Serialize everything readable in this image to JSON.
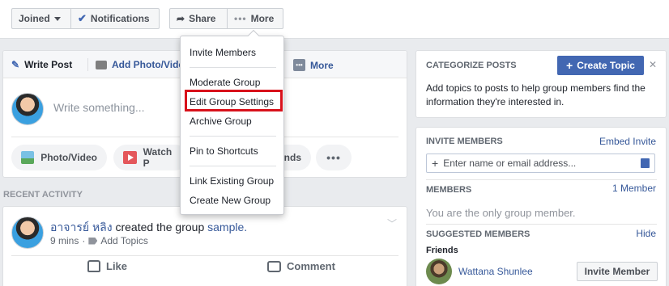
{
  "header": {
    "joined_label": "Joined",
    "notifications_label": "Notifications",
    "share_label": "Share",
    "more_label": "More"
  },
  "more_menu": {
    "items": [
      "Invite Members",
      "Moderate Group",
      "Edit Group Settings",
      "Archive Group",
      "Pin to Shortcuts",
      "Link Existing Group",
      "Create New Group"
    ],
    "highlighted_item": "Edit Group Settings",
    "highlight_color": "#d8111b"
  },
  "composer": {
    "tab_write": "Write Post",
    "tab_photo": "Add Photo/Vide",
    "tab_more": "More",
    "placeholder": "Write something...",
    "pill_photo": "Photo/Video",
    "pill_watch": "Watch P",
    "pill_friends": "nds",
    "pill_more": "•••"
  },
  "recent_activity": {
    "label": "RECENT ACTIVITY",
    "author": "อาจารย์ หลิง",
    "action": "created the group",
    "group_name": "sample.",
    "time": "9 mins",
    "add_topics": "Add Topics",
    "like_label": "Like",
    "comment_label": "Comment"
  },
  "categorize": {
    "title": "CATEGORIZE POSTS",
    "create_topic_label": "Create Topic",
    "description": "Add topics to posts to help group members find the information they're interested in."
  },
  "invite": {
    "title": "INVITE MEMBERS",
    "embed_link": "Embed Invite",
    "input_placeholder": "Enter name or email address...",
    "members_title": "MEMBERS",
    "members_count": "1 Member",
    "only_member_text": "You are the only group member.",
    "suggested_title": "SUGGESTED MEMBERS",
    "hide_link": "Hide",
    "friends_label": "Friends",
    "friend_name": "Wattana Shunlee",
    "invite_button": "Invite Member"
  },
  "colors": {
    "accent": "#4267b2",
    "link": "#365899",
    "page_bg": "#e9ebee"
  }
}
